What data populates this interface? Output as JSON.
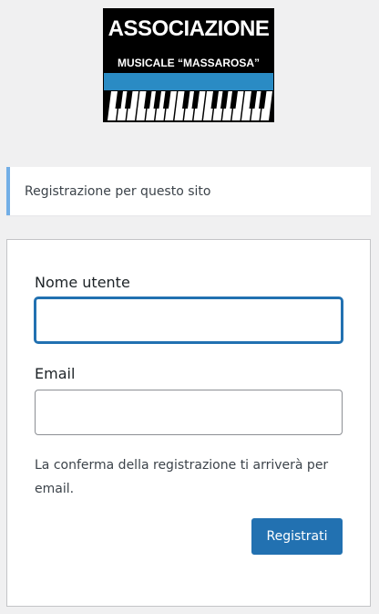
{
  "logo": {
    "line1": "ASSOCIAZIONE",
    "line2": "MUSICALE “MASSAROSA”"
  },
  "notice": {
    "message": "Registrazione per questo sito"
  },
  "form": {
    "username_label": "Nome utente",
    "username_value": "",
    "email_label": "Email",
    "email_value": "",
    "confirmation_note": "La conferma della registrazione ti arriverà per email.",
    "submit_label": "Registrati"
  },
  "colors": {
    "background": "#f0f0f1",
    "accent": "#2271b1",
    "notice_border": "#72aee6",
    "logo_blue": "#2a8bc4"
  }
}
